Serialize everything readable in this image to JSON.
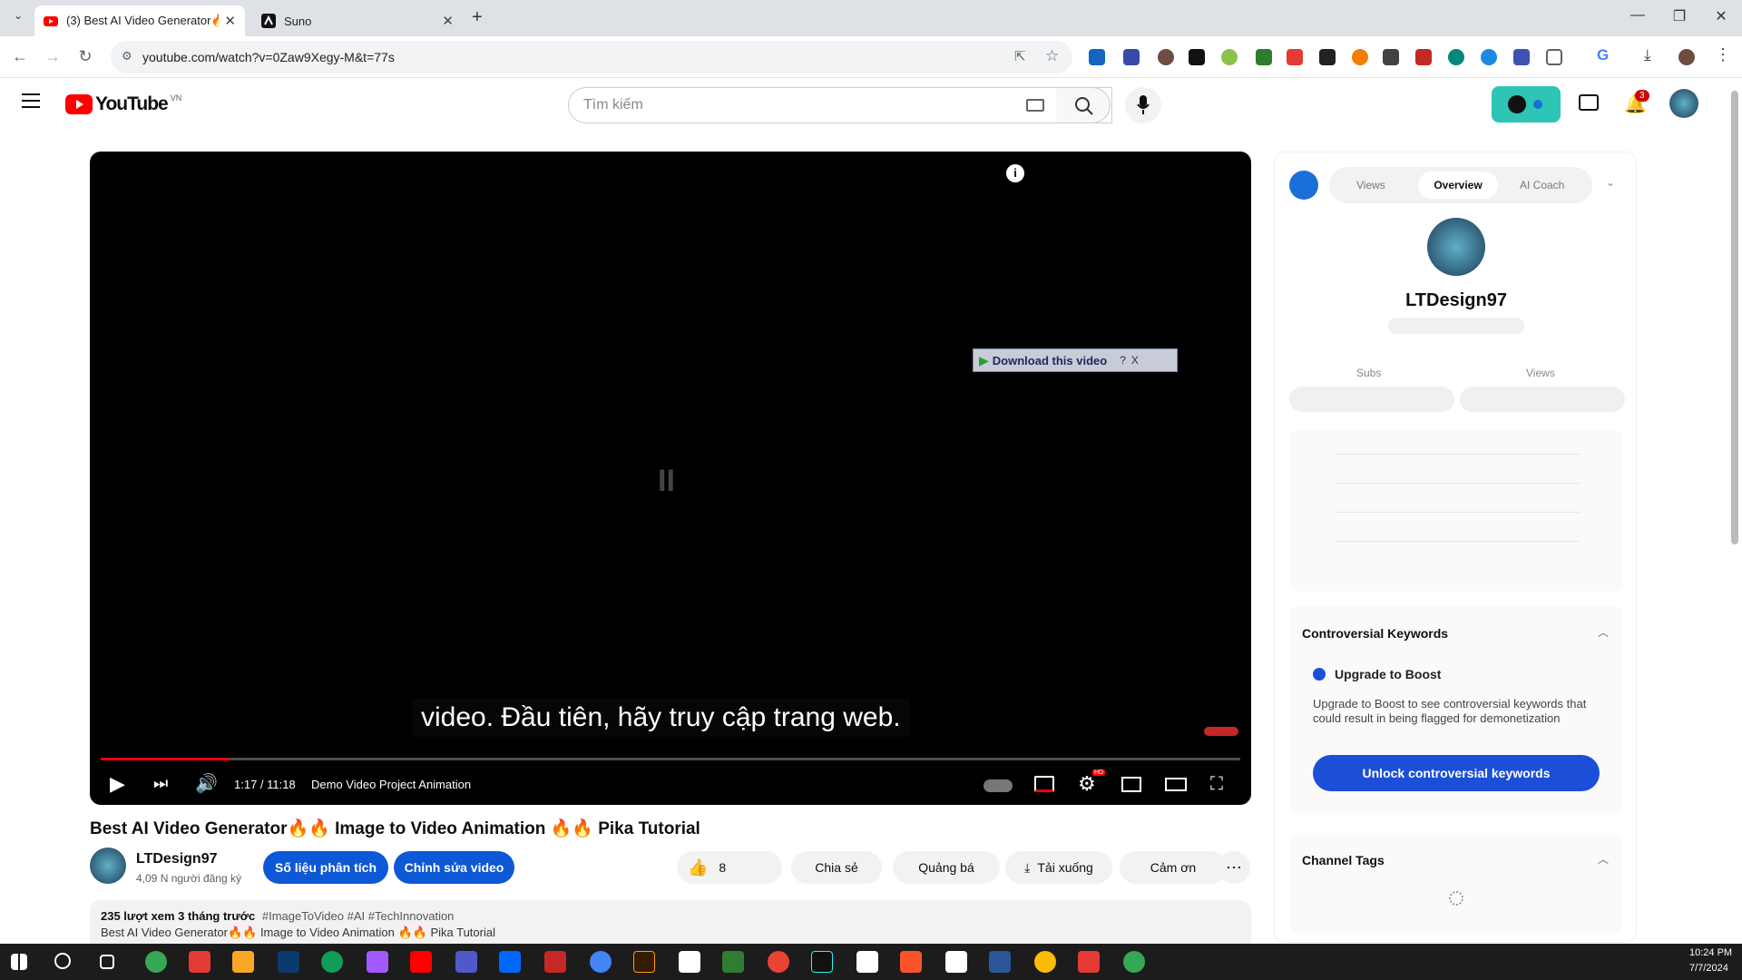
{
  "browser": {
    "tabs": [
      {
        "label": "(3) Best AI Video Generator🔥🔥",
        "active": true
      },
      {
        "label": "Suno",
        "active": false
      }
    ],
    "new_tab": "+",
    "url": "youtube.com/watch?v=0Zaw9Xegy-M&t=77s"
  },
  "youtube": {
    "logo_text": "YouTube",
    "region": "VN",
    "search_placeholder": "Tìm kiếm",
    "notif_count": "3"
  },
  "player": {
    "subtitle": "video. Đầu tiên, hãy truy cập trang web.",
    "time": "1:17 / 11:18",
    "chapter": "Demo Video Project Animation",
    "download_popup": "Download this video",
    "download_help": "?",
    "download_close": "X",
    "progress_fraction": 0.113,
    "hd_badge": "HD"
  },
  "video": {
    "title": "Best AI Video Generator🔥🔥 Image to Video Animation 🔥🔥 Pika Tutorial",
    "channel": "LTDesign97",
    "subs": "4,09 N người đăng ký",
    "btn_analytics": "Số liệu phân tích",
    "btn_edit": "Chỉnh sửa video",
    "likes": "8",
    "share": "Chia sẻ",
    "promote": "Quảng bá",
    "download": "Tải xuống",
    "thanks": "Cảm ơn",
    "desc_stats": "235 lượt xem  3 tháng trước",
    "desc_tags": "#ImageToVideo #AI #TechInnovation",
    "desc_line": "Best AI Video Generator🔥🔥 Image to Video Animation 🔥🔥 Pika Tutorial"
  },
  "side": {
    "tabs": [
      "Views",
      "Overview",
      "AI Coach"
    ],
    "active_tab": "Overview",
    "channel": "LTDesign97",
    "stat_labels": [
      "Subs",
      "Views"
    ],
    "controversial_title": "Controversial Keywords",
    "upgrade_title": "Upgrade to Boost",
    "upgrade_text": "Upgrade to Boost to see controversial keywords that could result in being flagged for demonetization",
    "unlock_btn": "Unlock controversial keywords",
    "tags_title": "Channel Tags"
  },
  "taskbar": {
    "time": "10:24 PM",
    "date": "7/7/2024"
  },
  "colors": {
    "yt_red": "#ff0000",
    "boost_blue": "#1b4fd8",
    "teal": "#2ec4b6"
  }
}
